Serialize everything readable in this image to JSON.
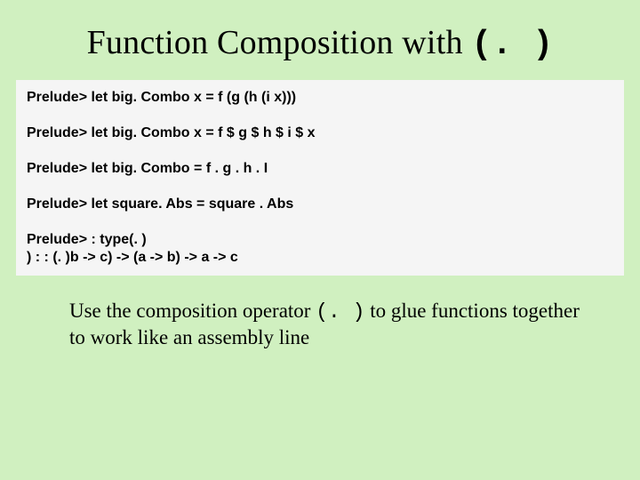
{
  "title": {
    "prefix": "Function Composition with ",
    "mono": "(. )"
  },
  "code": {
    "lines": [
      "Prelude> let big. Combo x = f (g (h (i x)))",
      "Prelude> let big. Combo x = f $ g $ h $ i $ x",
      "Prelude> let big. Combo = f . g . h . I",
      "Prelude> let square. Abs = square . Abs"
    ],
    "type_block": [
      "Prelude> : type(. )",
      ") : : (. )b -> c) -> (a -> b) -> a -> c"
    ]
  },
  "caption": {
    "pre": "Use the composition operator ",
    "mono": "(. )",
    "post": " to glue functions together to work like an assembly line"
  }
}
